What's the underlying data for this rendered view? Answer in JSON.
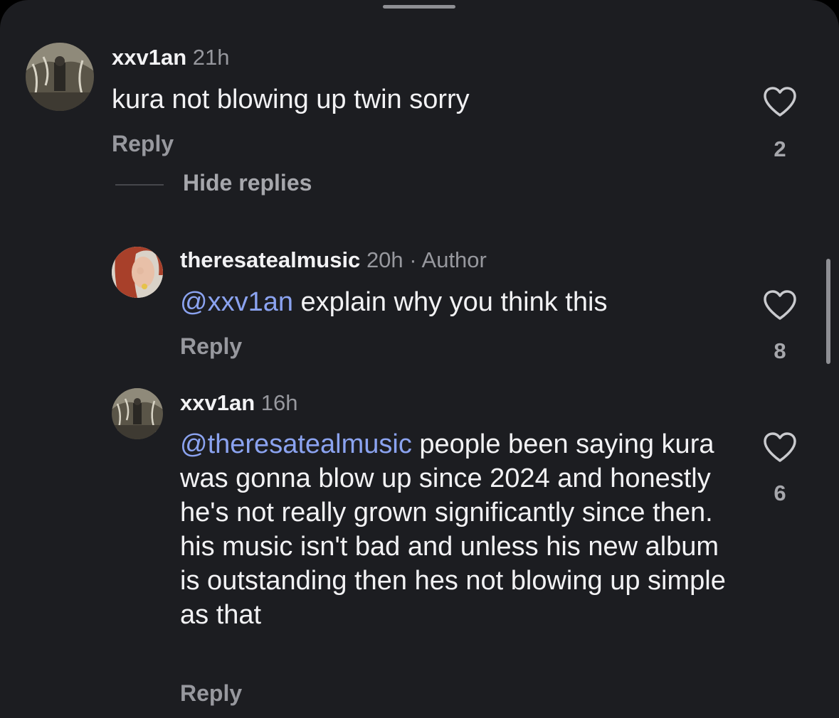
{
  "comments": [
    {
      "username": "xxv1an",
      "time": "21h",
      "author_tag": "",
      "mention": "",
      "text": "kura not blowing up twin sorry",
      "reply_label": "Reply",
      "like_count": "2"
    },
    {
      "username": "theresatealmusic",
      "time": "20h",
      "author_tag": "· Author",
      "mention": "@xxv1an",
      "text": "explain why you think this",
      "reply_label": "Reply",
      "like_count": "8"
    },
    {
      "username": "xxv1an",
      "time": "16h",
      "author_tag": "",
      "mention": "@theresatealmusic",
      "text": "people been saying kura was gonna blow up since 2024 and honestly he's not really grown significantly since then. his music isn't bad and unless his new album is outstanding then hes not blowing up simple as that",
      "reply_label": "Reply",
      "like_count": "6"
    }
  ],
  "thread": {
    "hide_replies_label": "Hide replies"
  },
  "icons": {
    "like": "heart-outline-icon",
    "grabber": "sheet-handle"
  },
  "colors": {
    "background": "#1c1d21",
    "text": "#f2f2f4",
    "muted": "#97989e",
    "mention": "#8ba3f0"
  }
}
